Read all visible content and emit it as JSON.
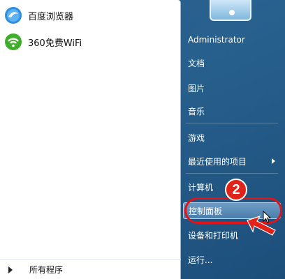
{
  "left_pane": {
    "programs": [
      {
        "label": "百度浏览器",
        "icon": "baidu-browser-icon"
      },
      {
        "label": "360免费WiFi",
        "icon": "wifi-360-icon"
      }
    ],
    "all_programs_label": "所有程序"
  },
  "right_pane": {
    "items": [
      {
        "label": "Administrator"
      },
      {
        "label": "文档"
      },
      {
        "label": "图片"
      },
      {
        "label": "音乐"
      },
      {
        "label": "游戏"
      },
      {
        "label": "最近使用的项目"
      },
      {
        "label": "计算机"
      },
      {
        "label": "控制面板"
      },
      {
        "label": "设备和打印机"
      },
      {
        "label": "运行..."
      }
    ]
  },
  "annotation": {
    "step_number": "2",
    "color": "#e2231a"
  }
}
